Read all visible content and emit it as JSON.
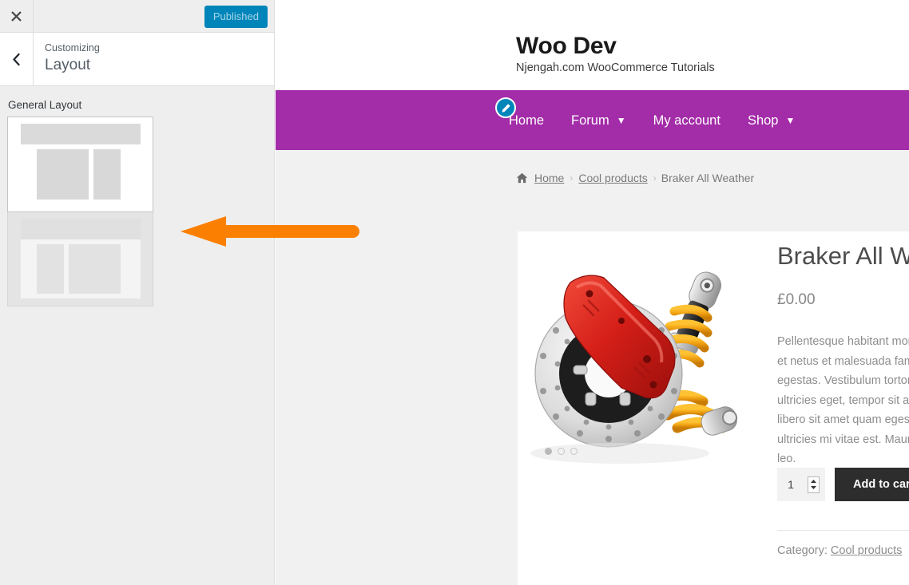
{
  "customizer": {
    "close_icon": "close-icon",
    "back_icon": "chevron-left-icon",
    "publish_label": "Published",
    "eyebrow": "Customizing",
    "title": "Layout",
    "section_label": "General Layout",
    "layout_options": [
      {
        "name": "content-left-sidebar-right",
        "selected": true
      },
      {
        "name": "sidebar-left-content-right",
        "selected": false
      }
    ]
  },
  "annotation": {
    "type": "arrow",
    "direction": "left",
    "color": "#fb7f00",
    "points_to": "layout-option-2"
  },
  "preview": {
    "site": {
      "title": "Woo Dev",
      "tagline": "Njengah.com WooCommerce Tutorials"
    },
    "nav": {
      "accent_color": "#a32ca8",
      "edit_icon": "pencil-icon",
      "items": [
        {
          "label": "Home",
          "has_dropdown": false
        },
        {
          "label": "Forum",
          "has_dropdown": true
        },
        {
          "label": "My account",
          "has_dropdown": false
        },
        {
          "label": "Shop",
          "has_dropdown": true
        }
      ]
    },
    "breadcrumb": {
      "home_icon": "home-icon",
      "separator": "›",
      "items": [
        {
          "label": "Home",
          "link": true
        },
        {
          "label": "Cool products",
          "link": true
        },
        {
          "label": "Braker All Weather",
          "link": false
        }
      ]
    },
    "product": {
      "title": "Braker All Weather",
      "price": "£0.00",
      "description": "Pellentesque habitant morbi tristique senectus et netus et malesuada fames ac turpis egestas. Vestibulum tortor quam, feugiat vitae, ultricies eget, tempor sit amet, ante. Donec eu libero sit amet quam egestas semper. Aenean ultricies mi vitae est. Mauris placerat eleifend leo.",
      "quantity": "1",
      "add_to_cart_label": "Add to cart",
      "meta_prefix": "Category:",
      "category": "Cool products",
      "gallery": {
        "image_alt": "brake-disc-caliper-coilover-image",
        "dots": [
          {
            "active": true
          },
          {
            "active": false
          },
          {
            "active": false
          }
        ]
      }
    }
  }
}
